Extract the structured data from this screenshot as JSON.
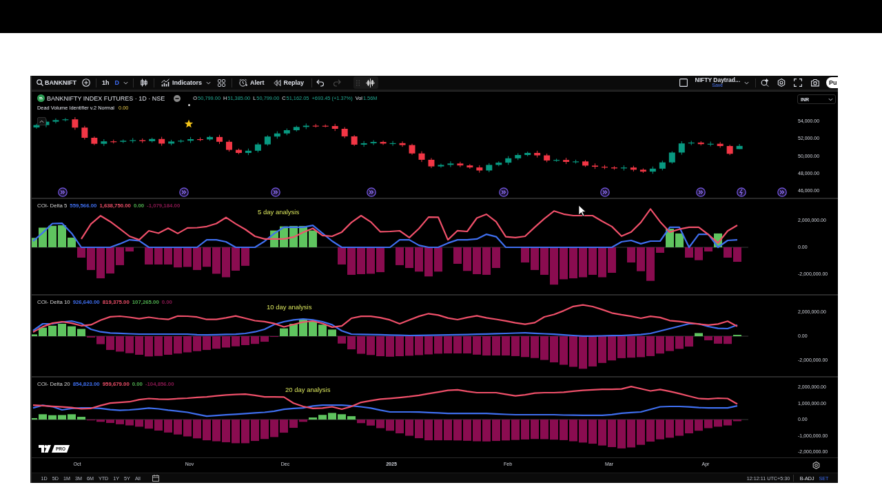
{
  "toolbar": {
    "symbol": "BANKNIFT",
    "intervals": [
      {
        "label": "1h",
        "selected": false
      },
      {
        "label": "D",
        "selected": true
      }
    ],
    "indicators": "Indicators",
    "alert": "Alert",
    "replay": "Replay",
    "history": [
      {
        "disabled": false
      },
      {
        "disabled": true
      }
    ],
    "layout_name": "NIFTY Daytrad...",
    "layout_status": "Save",
    "publish": "Pu"
  },
  "main_pane": {
    "title": "BANKNIFTY INDEX FUTURES · 1D · NSE",
    "ohlc": [
      {
        "label": "O",
        "value": "50,799.00"
      },
      {
        "label": "H",
        "value": "51,385.00"
      },
      {
        "label": "L",
        "value": "50,799.00"
      },
      {
        "label": "C",
        "value": "51,162.05"
      }
    ],
    "change": "+693.45 (+1.37%)",
    "volume": {
      "label": "Vol",
      "value": "1.56M"
    },
    "study": {
      "name": "Dead Volume Identifier v.2 Normal",
      "value": "0.00"
    },
    "currency": "INR",
    "chart_data": {
      "type": "candlestick",
      "ylim": [
        45130,
        57485
      ],
      "yticks": [
        {
          "value": 54000,
          "label": "54,000.00"
        },
        {
          "value": 52000,
          "label": "52,000.00"
        },
        {
          "value": 50000,
          "label": "50,000.00"
        },
        {
          "value": 48000,
          "label": "48,000.00"
        },
        {
          "value": 46000,
          "label": "46,000.00"
        }
      ],
      "categories": [
        null,
        null,
        null,
        null,
        null,
        null,
        null,
        null,
        null,
        null,
        null,
        null,
        null,
        null,
        null,
        null,
        null,
        null,
        null,
        null,
        null,
        null,
        null,
        null,
        null,
        null,
        null,
        null,
        null,
        null,
        null,
        null,
        null,
        null,
        null,
        null,
        null,
        null,
        null,
        null,
        null,
        null,
        null,
        null,
        null,
        null,
        null,
        null,
        null,
        null,
        null,
        null,
        null,
        null,
        null,
        null,
        null,
        null,
        null,
        null,
        null,
        null,
        null,
        null,
        null,
        null,
        null,
        null,
        null,
        null,
        null,
        null,
        null,
        null,
        null,
        null,
        null,
        null,
        null
      ],
      "ohlc": [
        [
          53290,
          53710,
          53140,
          53560
        ],
        [
          53560,
          54200,
          53310,
          53950
        ],
        [
          53950,
          54330,
          53750,
          54130
        ],
        [
          54130,
          54370,
          53980,
          54220
        ],
        [
          54220,
          54470,
          53020,
          53270
        ],
        [
          53270,
          53470,
          51900,
          52100
        ],
        [
          52100,
          52250,
          51260,
          51410
        ],
        [
          51410,
          51940,
          51160,
          51690
        ],
        [
          51690,
          51890,
          51440,
          51640
        ],
        [
          51640,
          51910,
          51490,
          51760
        ],
        [
          51760,
          52070,
          51510,
          51820
        ],
        [
          51820,
          52020,
          51510,
          51710
        ],
        [
          51710,
          52110,
          51560,
          51960
        ],
        [
          51960,
          52210,
          51180,
          51430
        ],
        [
          51430,
          51870,
          51230,
          51670
        ],
        [
          51670,
          51910,
          51520,
          51760
        ],
        [
          51760,
          52190,
          51510,
          51940
        ],
        [
          51940,
          52140,
          51710,
          51910
        ],
        [
          51910,
          52340,
          51760,
          52190
        ],
        [
          52190,
          52440,
          51390,
          51640
        ],
        [
          51640,
          51840,
          50510,
          50710
        ],
        [
          50710,
          50860,
          50210,
          50360
        ],
        [
          50360,
          50860,
          50110,
          50610
        ],
        [
          50610,
          51540,
          50410,
          51340
        ],
        [
          51340,
          52390,
          51190,
          52240
        ],
        [
          52240,
          52850,
          51990,
          52600
        ],
        [
          52600,
          53170,
          52400,
          52970
        ],
        [
          52970,
          53490,
          52820,
          53340
        ],
        [
          53340,
          53740,
          53090,
          53490
        ],
        [
          53490,
          53690,
          53280,
          53480
        ],
        [
          53480,
          53630,
          53300,
          53450
        ],
        [
          53450,
          53700,
          52880,
          53130
        ],
        [
          53130,
          53330,
          52060,
          52260
        ],
        [
          52260,
          52410,
          51160,
          51310
        ],
        [
          51310,
          51720,
          51060,
          51470
        ],
        [
          51470,
          51820,
          51270,
          51620
        ],
        [
          51620,
          51770,
          51280,
          51430
        ],
        [
          51430,
          51730,
          51180,
          51480
        ],
        [
          51480,
          51680,
          51060,
          51260
        ],
        [
          51260,
          51410,
          50150,
          50300
        ],
        [
          50300,
          50550,
          49320,
          49570
        ],
        [
          49570,
          49770,
          48610,
          48810
        ],
        [
          48810,
          49130,
          48660,
          48980
        ],
        [
          48980,
          49390,
          48730,
          49140
        ],
        [
          49140,
          49340,
          48720,
          48920
        ],
        [
          48920,
          49070,
          48540,
          48690
        ],
        [
          48690,
          48940,
          48090,
          48340
        ],
        [
          48340,
          49180,
          48140,
          48980
        ],
        [
          48980,
          49390,
          48830,
          49240
        ],
        [
          49240,
          49990,
          48990,
          49740
        ],
        [
          49740,
          50320,
          49540,
          50120
        ],
        [
          50120,
          50510,
          49970,
          50360
        ],
        [
          50360,
          50610,
          49830,
          50080
        ],
        [
          50080,
          50280,
          49290,
          49490
        ],
        [
          49490,
          49700,
          49340,
          49550
        ],
        [
          49550,
          49800,
          49080,
          49330
        ],
        [
          49330,
          49580,
          49130,
          49380
        ],
        [
          49380,
          49530,
          48750,
          48900
        ],
        [
          48900,
          49150,
          48520,
          48770
        ],
        [
          48770,
          48970,
          48490,
          48690
        ],
        [
          48690,
          48840,
          48430,
          48580
        ],
        [
          48580,
          48930,
          48330,
          48680
        ],
        [
          48680,
          48880,
          48230,
          48430
        ],
        [
          48430,
          48580,
          48060,
          48210
        ],
        [
          48210,
          48800,
          47960,
          48550
        ],
        [
          48550,
          49470,
          48350,
          49270
        ],
        [
          49270,
          50550,
          49120,
          50400
        ],
        [
          50400,
          51700,
          50150,
          51450
        ],
        [
          51450,
          51750,
          51250,
          51550
        ],
        [
          51550,
          51700,
          51220,
          51370
        ],
        [
          51370,
          51660,
          51120,
          51410
        ],
        [
          51410,
          51610,
          50950,
          51150
        ],
        [
          51150,
          51300,
          50110,
          50260
        ],
        [
          50799,
          51385,
          50799,
          51162.05
        ],
        null,
        null,
        null,
        null,
        null
      ]
    }
  },
  "indicator_panes": [
    {
      "title": "COI- Delta 5",
      "values": [
        {
          "text": "559,566.00",
          "color": "#3f6ff0"
        },
        {
          "text": "1,638,750.00",
          "color": "#f0506a"
        },
        {
          "text": "0.00",
          "color": "#4fae4f"
        },
        {
          "text": "-1,079,184.00",
          "color": "#8a1850"
        }
      ],
      "note": "5 day analysis",
      "chart_data": {
        "type": "line",
        "ylim": [
          -3540000,
          3640000
        ],
        "yticks": [
          {
            "value": 2000000,
            "label": "2,000,000.00"
          },
          {
            "value": 0,
            "label": "0.00"
          },
          {
            "value": -2000000,
            "label": "-2,000,000.00"
          }
        ],
        "series": [
          {
            "color": "#3f6ff0",
            "values": [
              460000,
              1080000,
              1770000,
              1790000,
              1040000,
              0,
              0,
              0,
              0,
              260000,
              560000,
              490000,
              0,
              0,
              0,
              0,
              0,
              0,
              560000,
              560000,
              410000,
              0,
              0,
              0,
              450000,
              1030000,
              1490000,
              1490000,
              1490000,
              1630000,
              1040000,
              460000,
              0,
              0,
              0,
              0,
              0,
              0,
              560000,
              560000,
              150000,
              0,
              0,
              310000,
              560000,
              560000,
              620000,
              970000,
              790000,
              0,
              0,
              0,
              0,
              0,
              0,
              0,
              0,
              0,
              0,
              0,
              0,
              410000,
              510000,
              260000,
              460000,
              460000,
              1490000,
              1490000,
              0,
              970000,
              970000,
              0,
              510000,
              560000
            ]
          },
          {
            "color": "#f0506a",
            "values": [
              null,
              null,
              null,
              null,
              null,
              620000,
              1730000,
              2350000,
              1910000,
              1380000,
              820000,
              560000,
              1230000,
              1050000,
              1420000,
              1030000,
              1440000,
              1460000,
              1550000,
              1770000,
              2220000,
              1750000,
              1330000,
              820000,
              620000,
              620000,
              620000,
              760000,
              1110000,
              1410000,
              880000,
              820000,
              1130000,
              1850000,
              2360000,
              1890000,
              1160000,
              1180000,
              1230000,
              720000,
              1400000,
              2250000,
              2240000,
              560000,
              1240000,
              1180000,
              2180000,
              2460000,
              1900000,
              790000,
              720000,
              820000,
              1490000,
              2130000,
              2700000,
              2470000,
              2360000,
              2360000,
              2360000,
              1930000,
              1540000,
              830000,
              1140000,
              1850000,
              2850000,
              1900000,
              1130000,
              1350000,
              1490000,
              1490000,
              950000,
              320000,
              1220000,
              1640000
            ]
          },
          {
            "type": "bar",
            "color": "#5fc45f",
            "values": [
              700000,
              1460000,
              1600000,
              1640000,
              720000,
              0,
              0,
              0,
              0,
              0,
              0,
              0,
              0,
              0,
              0,
              0,
              0,
              0,
              0,
              0,
              0,
              0,
              0,
              0,
              0,
              1250000,
              1560000,
              1590000,
              1590000,
              1250000,
              0,
              0,
              0,
              0,
              0,
              0,
              0,
              0,
              0,
              0,
              0,
              0,
              0,
              0,
              0,
              0,
              0,
              0,
              0,
              0,
              0,
              0,
              0,
              0,
              0,
              0,
              0,
              0,
              0,
              0,
              0,
              0,
              0,
              0,
              0,
              0,
              1380000,
              1030000,
              0,
              0,
              0,
              1030000,
              0,
              0
            ]
          },
          {
            "type": "bar",
            "color": "#8a0c50",
            "values": [
              0,
              0,
              0,
              0,
              0,
              -770000,
              -1690000,
              -2310000,
              -1950000,
              -1330000,
              -310000,
              0,
              -1280000,
              -1280000,
              -1280000,
              -1500000,
              -1460000,
              -1690000,
              -1450000,
              -1970000,
              -2230000,
              -1740000,
              -1380000,
              0,
              0,
              0,
              0,
              0,
              0,
              0,
              0,
              0,
              -1280000,
              -2050000,
              -2000000,
              -1970000,
              -1850000,
              0,
              -1330000,
              -1540000,
              -1810000,
              -2170000,
              -1810000,
              0,
              -1230000,
              -1760000,
              -2000000,
              -2050000,
              -1540000,
              0,
              0,
              -1130000,
              -1690000,
              -2050000,
              -2780000,
              -2380000,
              -2310000,
              -2230000,
              -2050000,
              -2230000,
              -1900000,
              0,
              -1130000,
              -1780000,
              -2500000,
              -410000,
              0,
              0,
              -770000,
              -960000,
              -310000,
              0,
              -770000,
              -1080000
            ]
          }
        ]
      }
    },
    {
      "title": "COI- Delta 10",
      "values": [
        {
          "text": "926,640.00",
          "color": "#3f6ff0"
        },
        {
          "text": "819,375.00",
          "color": "#f0506a"
        },
        {
          "text": "107,265.00",
          "color": "#4fae4f"
        },
        {
          "text": "0.00",
          "color": "#8a1850"
        }
      ],
      "note": "10 day analysis",
      "chart_data": {
        "type": "line",
        "ylim": [
          -3370000,
          3430000
        ],
        "yticks": [
          {
            "value": 2000000,
            "label": "2,000,000.00"
          },
          {
            "value": 0,
            "label": "0.00"
          },
          {
            "value": -2000000,
            "label": "-2,000,000.00"
          }
        ],
        "series": [
          {
            "color": "#3f6ff0",
            "values": [
              460000,
              1030000,
              1030000,
              1170000,
              1260000,
              1060000,
              570000,
              360000,
              270000,
              240000,
              200000,
              170000,
              170000,
              170000,
              170000,
              170000,
              170000,
              130000,
              110000,
              130000,
              150000,
              160000,
              230000,
              360000,
              570000,
              970000,
              1200000,
              1350000,
              1430000,
              1350000,
              1200000,
              950000,
              440000,
              170000,
              150000,
              140000,
              120000,
              100000,
              80000,
              60000,
              70000,
              80000,
              100000,
              110000,
              130000,
              140000,
              160000,
              180000,
              210000,
              230000,
              260000,
              280000,
              240000,
              200000,
              160000,
              110000,
              60000,
              10000,
              10000,
              30000,
              50000,
              60000,
              100000,
              140000,
              230000,
              430000,
              630000,
              830000,
              1030000,
              1030000,
              800000,
              650000,
              630000,
              930000
            ]
          },
          {
            "color": "#f0506a",
            "values": [
              340000,
              780000,
              1080000,
              1200000,
              1080000,
              870000,
              950000,
              1330000,
              1610000,
              1660000,
              1570000,
              1450000,
              1570000,
              1460000,
              1390000,
              1670000,
              1660000,
              1590000,
              1390000,
              1390000,
              1520000,
              1680000,
              1490000,
              1290000,
              1210000,
              1050000,
              770000,
              970000,
              1170000,
              1260000,
              1060000,
              750000,
              850000,
              1490000,
              1650000,
              1650000,
              1540000,
              1350000,
              1030000,
              1350000,
              1650000,
              1870000,
              1750000,
              1510000,
              1370000,
              1550000,
              1690000,
              1530000,
              1400000,
              1270000,
              1110000,
              990000,
              1120000,
              1600000,
              1800000,
              2110000,
              2470000,
              2590000,
              2460000,
              2210000,
              1930000,
              1780000,
              1650000,
              1490000,
              1650000,
              1550000,
              1300000,
              1220000,
              1110000,
              1010000,
              930000,
              1010000,
              1240000,
              820000
            ]
          },
          {
            "type": "bar",
            "color": "#5fc45f",
            "values": [
              150000,
              710000,
              870000,
              1030000,
              820000,
              600000,
              0,
              0,
              0,
              0,
              0,
              0,
              0,
              0,
              0,
              0,
              0,
              0,
              0,
              0,
              0,
              0,
              0,
              0,
              0,
              0,
              650000,
              1030000,
              1430000,
              1230000,
              960000,
              550000,
              0,
              0,
              0,
              0,
              0,
              0,
              0,
              0,
              0,
              0,
              0,
              0,
              0,
              0,
              0,
              0,
              0,
              0,
              0,
              0,
              0,
              0,
              0,
              0,
              0,
              0,
              0,
              0,
              0,
              0,
              0,
              0,
              0,
              0,
              0,
              0,
              0,
              260000,
              0,
              0,
              0,
              110000
            ]
          },
          {
            "type": "bar",
            "color": "#8a0c50",
            "values": [
              0,
              0,
              0,
              0,
              0,
              0,
              -110000,
              -660000,
              -1140000,
              -1280000,
              -1410000,
              -1540000,
              -1680000,
              -1640000,
              -1540000,
              -1440000,
              -1340000,
              -1240000,
              -1140000,
              -1040000,
              -940000,
              -840000,
              -740000,
              -640000,
              -460000,
              -60000,
              0,
              0,
              0,
              0,
              0,
              0,
              -610000,
              -1090000,
              -1460000,
              -1560000,
              -1660000,
              -1700000,
              -1660000,
              -1620000,
              -1570000,
              -1510000,
              -1450000,
              -1430000,
              -1430000,
              -1430000,
              -1530000,
              -1600000,
              -1600000,
              -1600000,
              -1650000,
              -1730000,
              -1810000,
              -1970000,
              -2170000,
              -2370000,
              -2540000,
              -2700000,
              -2510000,
              -2220000,
              -2010000,
              -1820000,
              -1780000,
              -1740000,
              -1650000,
              -1440000,
              -1230000,
              -1050000,
              -860000,
              0,
              -340000,
              -620000,
              -640000,
              0
            ]
          }
        ]
      }
    },
    {
      "title": "COI- Delta 20",
      "values": [
        {
          "text": "854,823.00",
          "color": "#3f6ff0"
        },
        {
          "text": "959,679.00",
          "color": "#f0506a"
        },
        {
          "text": "0.00",
          "color": "#4fae4f"
        },
        {
          "text": "-104,856.00",
          "color": "#8a1850"
        }
      ],
      "note": "20 day analysis",
      "chart_data": {
        "type": "line",
        "ylim": [
          -2380000,
          2640000
        ],
        "yticks": [
          {
            "value": 2000000,
            "label": "2,000,000.00"
          },
          {
            "value": 1000000,
            "label": "1,000,000.00"
          },
          {
            "value": 0,
            "label": "0.00"
          },
          {
            "value": -1000000,
            "label": "-1,000,000.00"
          },
          {
            "value": -2000000,
            "label": "-2,000,000.00"
          }
        ],
        "series": [
          {
            "color": "#3f6ff0",
            "values": [
              720000,
              880000,
              800000,
              600000,
              690000,
              720000,
              720000,
              690000,
              610000,
              570000,
              600000,
              650000,
              710000,
              660000,
              580000,
              520000,
              450000,
              330000,
              210000,
              250000,
              290000,
              330000,
              370000,
              410000,
              450000,
              520000,
              630000,
              690000,
              720000,
              840000,
              890000,
              890000,
              890000,
              850000,
              790000,
              710000,
              580000,
              470000,
              470000,
              470000,
              460000,
              430000,
              410000,
              380000,
              380000,
              380000,
              380000,
              380000,
              350000,
              320000,
              300000,
              300000,
              300000,
              300000,
              300000,
              280000,
              270000,
              260000,
              260000,
              260000,
              310000,
              390000,
              430000,
              470000,
              630000,
              790000,
              810000,
              810000,
              780000,
              740000,
              720000,
              720000,
              720000,
              850000
            ]
          },
          {
            "color": "#f0506a",
            "values": [
              890000,
              860000,
              820000,
              780000,
              740000,
              660000,
              690000,
              870000,
              1020000,
              1060000,
              1100000,
              1230000,
              1300000,
              1260000,
              1250000,
              1290000,
              1320000,
              1370000,
              1400000,
              1460000,
              1520000,
              1550000,
              1570000,
              1500000,
              1400000,
              1400000,
              1390000,
              1010000,
              810000,
              690000,
              710000,
              790000,
              640000,
              810000,
              1060000,
              1170000,
              1260000,
              1310000,
              1360000,
              1420000,
              1500000,
              1600000,
              1700000,
              1800000,
              1840000,
              1740000,
              1660000,
              1660000,
              1660000,
              1560000,
              1460000,
              1530000,
              1630000,
              1660000,
              1660000,
              1690000,
              1750000,
              1800000,
              1840000,
              1870000,
              1870000,
              1890000,
              2040000,
              1910000,
              1770000,
              1860000,
              1740000,
              1600000,
              1450000,
              1300000,
              1270000,
              1320000,
              1300000,
              960000
            ]
          },
          {
            "type": "bar",
            "color": "#5fc45f",
            "values": [
              90000,
              330000,
              270000,
              280000,
              330000,
              170000,
              0,
              0,
              0,
              0,
              0,
              0,
              0,
              0,
              0,
              0,
              0,
              0,
              0,
              0,
              0,
              0,
              0,
              0,
              0,
              0,
              0,
              0,
              0,
              130000,
              290000,
              410000,
              330000,
              210000,
              0,
              0,
              0,
              0,
              0,
              0,
              0,
              0,
              0,
              0,
              0,
              0,
              0,
              0,
              0,
              0,
              0,
              0,
              0,
              0,
              0,
              0,
              0,
              0,
              0,
              0,
              0,
              0,
              0,
              0,
              0,
              0,
              0,
              0,
              0,
              0,
              0,
              0,
              0,
              0
            ]
          },
          {
            "type": "bar",
            "color": "#8a0c50",
            "values": [
              0,
              0,
              0,
              0,
              0,
              0,
              -50000,
              -140000,
              -210000,
              -290000,
              -360000,
              -440000,
              -560000,
              -680000,
              -800000,
              -920000,
              -1040000,
              -1160000,
              -1280000,
              -1340000,
              -1400000,
              -1460000,
              -1460000,
              -1320000,
              -1200000,
              -1080000,
              -810000,
              -510000,
              -140000,
              0,
              0,
              0,
              0,
              0,
              -220000,
              -370000,
              -530000,
              -690000,
              -850000,
              -1000000,
              -1150000,
              -1280000,
              -1280000,
              -1280000,
              -1290000,
              -1310000,
              -1340000,
              -1350000,
              -1320000,
              -1290000,
              -1260000,
              -1230000,
              -1200000,
              -1210000,
              -1240000,
              -1270000,
              -1340000,
              -1420000,
              -1490000,
              -1600000,
              -1700000,
              -1780000,
              -1720000,
              -1560000,
              -1360000,
              -1220000,
              -1120000,
              -1000000,
              -850000,
              -690000,
              -530000,
              -440000,
              -360000,
              -100000
            ]
          }
        ]
      }
    }
  ],
  "logo_badge": "PRO",
  "time_axis": [
    {
      "label": "Oct",
      "kind": "month"
    },
    {
      "label": "Nov",
      "kind": "month"
    },
    {
      "label": "Dec",
      "kind": "month"
    },
    {
      "label": "2025",
      "kind": "year"
    },
    {
      "label": "Feb",
      "kind": "month"
    },
    {
      "label": "Mar",
      "kind": "month"
    },
    {
      "label": "Apr",
      "kind": "month"
    }
  ],
  "range_buttons": [
    "1D",
    "5D",
    "1M",
    "3M",
    "6M",
    "YTD",
    "1Y",
    "5Y",
    "All"
  ],
  "status_bar": {
    "time": "12:12:11 UTC+5:30",
    "adjustment": "B-ADJ",
    "session": "SET"
  }
}
